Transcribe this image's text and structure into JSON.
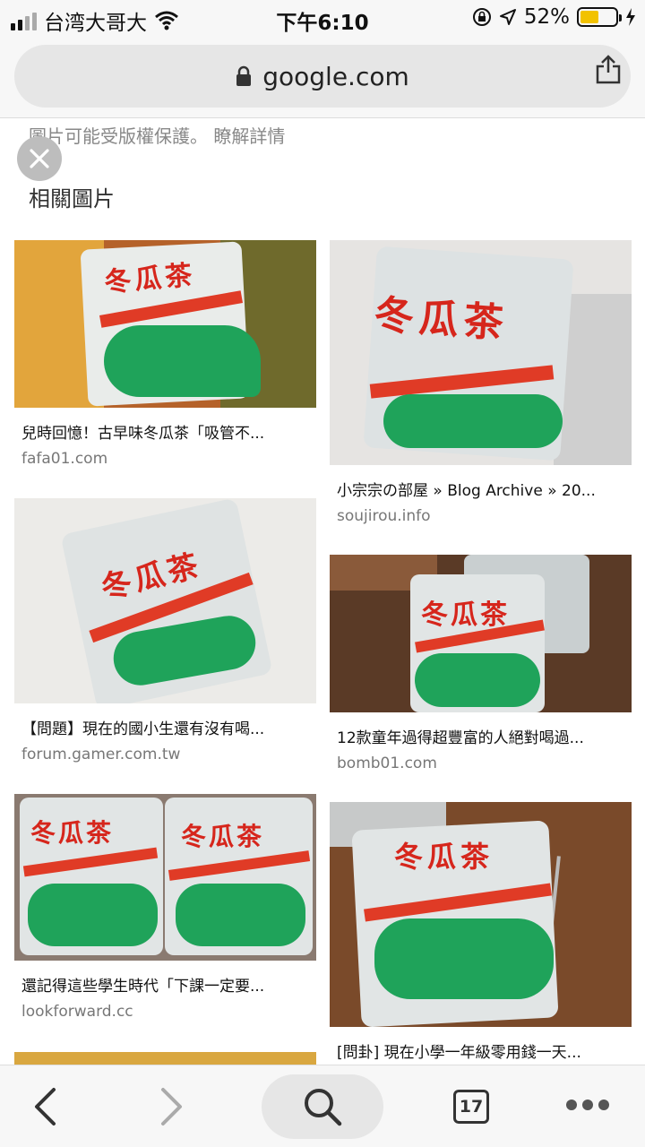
{
  "status_bar": {
    "carrier": "台湾大哥大",
    "time": "下午6:10",
    "battery": "52%",
    "battery_level": 0.52
  },
  "url_bar": {
    "domain": "google.com"
  },
  "content": {
    "copyright_notice": "圖片可能受版權保護。 瞭解詳情",
    "related_heading": "相關圖片",
    "results": [
      {
        "title": "兒時回憶！古早味冬瓜茶「吸管不...",
        "domain": "fafa01.com",
        "image_text": "冬瓜茶"
      },
      {
        "title": "小宗宗の部屋 » Blog Archive » 20...",
        "domain": "soujirou.info",
        "image_text": "冬瓜茶"
      },
      {
        "title": "【問題】現在的國小生還有沒有喝...",
        "domain": "forum.gamer.com.tw",
        "image_text": "冬瓜茶"
      },
      {
        "title": "12款童年過得超豐富的人絕對喝過...",
        "domain": "bomb01.com",
        "image_text": "冬瓜茶"
      },
      {
        "title": "還記得這些學生時代「下課一定要...",
        "domain": "lookforward.cc",
        "image_text": "冬瓜茶"
      },
      {
        "title": "[問卦] 現在小學一年級零用錢一天...",
        "domain": "",
        "image_text": "冬瓜茶"
      }
    ]
  },
  "toolbar": {
    "tab_count": "17"
  }
}
